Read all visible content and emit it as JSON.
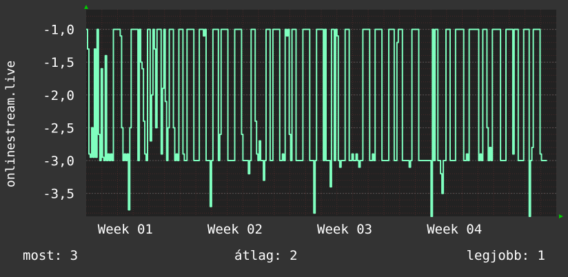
{
  "chart_data": {
    "type": "line",
    "ylabel": "onlinestream.live",
    "y_ticks": [
      "-1,0",
      "-1,5",
      "-2,0",
      "-2,5",
      "-3,0",
      "-3,5"
    ],
    "y_tick_values": [
      -1.0,
      -1.5,
      -2.0,
      -2.5,
      -3.0,
      -3.5
    ],
    "ylim": [
      -3.85,
      -0.7
    ],
    "x_ticks": [
      "Week 01",
      "Week 02",
      "Week 03",
      "Week 04"
    ],
    "x_tick_positions_days": [
      2.5,
      9.5,
      16.5,
      23.5
    ],
    "xlim_days": [
      0,
      30
    ],
    "grid": true,
    "series_color": "#7fffbf",
    "series": [
      {
        "values": [
          -1.0,
          -1.3,
          -2.9,
          -2.95,
          -2.5,
          -2.95,
          -1.3,
          -2.95,
          -1.0,
          -2.6,
          -3.0,
          -1.6,
          -2.95,
          -3.0,
          -1.4,
          -3.0,
          -2.9,
          -3.0,
          -2.9,
          -3.0,
          -1.0,
          -1.0,
          -1.0,
          -1.0,
          -1.0,
          -1.1,
          -2.5,
          -3.0,
          -2.9,
          -3.0,
          -2.9,
          -3.75,
          -2.5,
          -1.0,
          -1.0,
          -1.0,
          -1.0,
          -1.0,
          -3.0,
          -1.0,
          -1.5,
          -1.6,
          -2.4,
          -2.9,
          -3.0,
          -1.0,
          -1.0,
          -2.7,
          -2.0,
          -1.0,
          -1.3,
          -2.5,
          -1.0,
          -1.0,
          -1.0,
          -2.9,
          -1.9,
          -1.0,
          -2.1,
          -3.0,
          -2.5,
          -1.0,
          -1.0,
          -1.0,
          -2.5,
          -3.0,
          -2.9,
          -3.0,
          -1.0,
          -1.0,
          -1.0,
          -2.9,
          -3.0,
          -3.0,
          -1.0,
          -1.0,
          -1.0,
          -1.0,
          -1.0,
          -3.0,
          -3.0,
          -3.0,
          -3.0,
          -1.0,
          -1.0,
          -1.0,
          -1.1,
          -1.0,
          -3.0,
          -3.0,
          -3.0,
          -3.7,
          -3.0,
          -1.0,
          -1.0,
          -1.0,
          -1.0,
          -3.0,
          -2.6,
          -1.0,
          -1.0,
          -1.0,
          -1.0,
          -1.0,
          -3.0,
          -3.0,
          -3.0,
          -3.0,
          -3.0,
          -1.0,
          -1.0,
          -1.0,
          -1.0,
          -1.0,
          -2.6,
          -3.0,
          -3.0,
          -3.0,
          -3.0,
          -3.2,
          -3.0,
          -1.0,
          -1.0,
          -1.0,
          -2.4,
          -2.9,
          -3.0,
          -2.7,
          -3.0,
          -3.0,
          -3.3,
          -3.0,
          -1.0,
          -1.0,
          -1.0,
          -3.0,
          -3.0,
          -1.0,
          -1.0,
          -1.0,
          -1.0,
          -1.0,
          -3.0,
          -3.0,
          -2.9,
          -3.0,
          -1.0,
          -1.1,
          -1.0,
          -2.6,
          -3.0,
          -1.0,
          -1.0,
          -1.0,
          -3.0,
          -3.0,
          -3.0,
          -3.0,
          -3.0,
          -1.0,
          -1.0,
          -1.0,
          -1.0,
          -1.0,
          -3.0,
          -3.0,
          -3.0,
          -3.8,
          -3.0,
          -1.0,
          -1.0,
          -1.0,
          -1.0,
          -1.0,
          -3.0,
          -1.0,
          -3.0,
          -3.0,
          -3.0,
          -3.4,
          -1.0,
          -1.0,
          -3.0,
          -1.0,
          -1.1,
          -3.0,
          -3.1,
          -3.0,
          -3.0,
          -3.0,
          -1.0,
          -1.0,
          -1.0,
          -3.0,
          -3.0,
          -2.9,
          -3.0,
          -3.0,
          -2.9,
          -3.0,
          -3.1,
          -3.0,
          -3.0,
          -1.0,
          -1.0,
          -1.0,
          -1.0,
          -1.0,
          -3.0,
          -3.0,
          -2.9,
          -3.0,
          -1.0,
          -1.0,
          -1.0,
          -1.0,
          -1.0,
          -3.0,
          -3.0,
          -3.0,
          -3.0,
          -3.0,
          -1.0,
          -1.0,
          -1.0,
          -1.0,
          -3.0,
          -3.0,
          -1.2,
          -1.0,
          -1.0,
          -1.0,
          -3.0,
          -3.0,
          -3.0,
          -3.0,
          -3.0,
          -3.1,
          -3.0,
          -1.0,
          -1.0,
          -1.0,
          -1.0,
          -1.0,
          -3.0,
          -3.0,
          -3.0,
          -3.0,
          -3.0,
          -3.0,
          -3.0,
          -3.0,
          -3.0,
          -3.85,
          -1.0,
          -3.0,
          -1.0,
          -1.0,
          -3.0,
          -3.0,
          -3.2,
          -3.5,
          -3.0,
          -3.0,
          -1.0,
          -1.0,
          -1.0,
          -3.0,
          -3.0,
          -3.0,
          -3.0,
          -1.0,
          -1.0,
          -1.0,
          -1.0,
          -1.0,
          -1.0,
          -3.0,
          -3.0,
          -2.9,
          -3.0,
          -1.0,
          -1.0,
          -1.0,
          -1.0,
          -1.0,
          -1.0,
          -1.0,
          -3.0,
          -2.9,
          -3.0,
          -1.0,
          -1.0,
          -1.0,
          -2.5,
          -3.0,
          -2.8,
          -3.0,
          -1.0,
          -1.0,
          -1.0,
          -1.0,
          -1.0,
          -1.0,
          -3.0,
          -3.0,
          -3.0,
          -3.0,
          -1.0,
          -1.0,
          -1.0,
          -1.0,
          -1.0,
          -2.9,
          -1.0,
          -1.0,
          -1.0,
          -3.0,
          -3.0,
          -3.0,
          -3.0,
          -1.0,
          -1.0,
          -1.0,
          -1.0,
          -3.85,
          -3.0,
          -2.8,
          -1.0,
          -1.0,
          -1.0,
          -1.0,
          -1.0,
          -2.9,
          -3.0,
          -3.0,
          -3.0,
          -3.0
        ],
        "x_start_days": 0,
        "x_end_days": 29.4
      }
    ]
  },
  "footer": {
    "current": "most: 3",
    "average": "átlag: 2",
    "best": "legjobb: 1"
  },
  "colors": {
    "background": "#333333",
    "plot_background": "#222222",
    "grid": "#3c3c3c",
    "grid_minor": "#4a2a2a",
    "axis_arrow": "#00cc00"
  }
}
